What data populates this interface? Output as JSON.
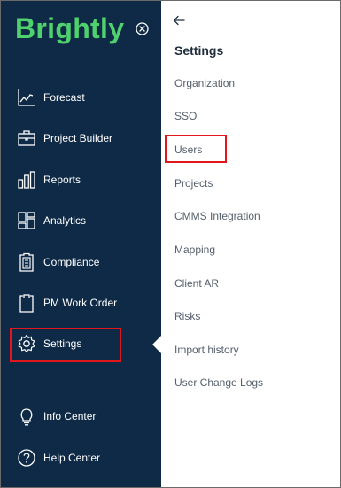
{
  "brand": {
    "name": "Brightly",
    "color": "#4fd16d"
  },
  "colors": {
    "sidebar_bg": "#0e2a46",
    "highlight": "#e0181b",
    "panel_text": "#55606b"
  },
  "sidebar": {
    "collapse_icon": "close-circle-icon",
    "items": [
      {
        "label": "Forecast",
        "icon": "chart-line-icon"
      },
      {
        "label": "Project Builder",
        "icon": "briefcase-icon"
      },
      {
        "label": "Reports",
        "icon": "bar-chart-icon"
      },
      {
        "label": "Analytics",
        "icon": "dashboard-grid-icon"
      },
      {
        "label": "Compliance",
        "icon": "document-icon"
      },
      {
        "label": "PM Work Order",
        "icon": "clipboard-icon"
      },
      {
        "label": "Settings",
        "icon": "gear-icon"
      },
      {
        "label": "Info Center",
        "icon": "lightbulb-icon"
      },
      {
        "label": "Help Center",
        "icon": "question-circle-icon"
      }
    ]
  },
  "settings_panel": {
    "back_icon": "arrow-left-icon",
    "title": "Settings",
    "items": [
      "Organization",
      "SSO",
      "Users",
      "Projects",
      "CMMS Integration",
      "Mapping",
      "Client AR",
      "Risks",
      "Import history",
      "User Change Logs"
    ]
  }
}
